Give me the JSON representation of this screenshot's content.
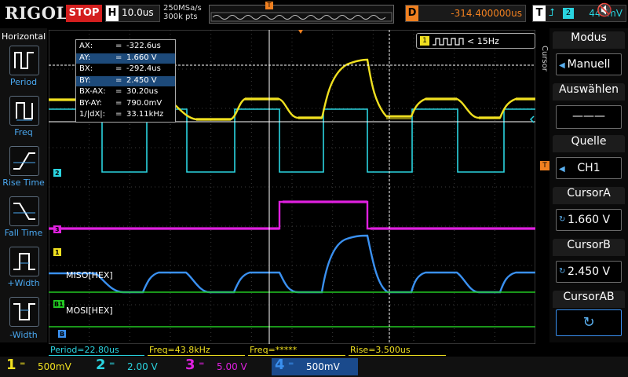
{
  "header": {
    "brand": "RIGOL",
    "run_state": "STOP",
    "timebase_label": "H",
    "timebase": "10.0us",
    "sample_rate": "250MSa/s",
    "memory_depth": "300k pts",
    "trigger_pos_marker": "T",
    "delay_label": "D",
    "delay": "-314.400000us",
    "trigger_label": "T",
    "trigger_edge_icon": "rising-edge-icon",
    "trigger_source": "2",
    "trigger_level": "440mV"
  },
  "left_panel": {
    "title": "Horizontal",
    "items": [
      {
        "label": "Period",
        "icon": "period-icon"
      },
      {
        "label": "Freq",
        "icon": "freq-icon"
      },
      {
        "label": "Rise Time",
        "icon": "rise-time-icon"
      },
      {
        "label": "Fall Time",
        "icon": "fall-time-icon"
      },
      {
        "label": "+Width",
        "icon": "positive-width-icon"
      },
      {
        "label": "-Width",
        "icon": "negative-width-icon"
      }
    ]
  },
  "cursor_readout": {
    "rows": [
      {
        "key": "AX:",
        "eq": "=",
        "value": "-322.6us",
        "selected": false
      },
      {
        "key": "AY:",
        "eq": "=",
        "value": "1.660 V",
        "selected": true
      },
      {
        "key": "BX:",
        "eq": "=",
        "value": "-292.4us",
        "selected": false
      },
      {
        "key": "BY:",
        "eq": "=",
        "value": "2.450 V",
        "selected": true
      },
      {
        "key": "BX-AX:",
        "eq": "=",
        "value": "30.20us",
        "selected": false
      },
      {
        "key": "BY-AY:",
        "eq": "=",
        "value": "790.0mV",
        "selected": false
      },
      {
        "key": "1/|dX|:",
        "eq": "=",
        "value": "33.11kHz",
        "selected": false
      }
    ]
  },
  "freq_counter": {
    "channel": "1",
    "text": "< 15Hz"
  },
  "waveform_labels": {
    "miso": "MISO[HEX]",
    "mosi": "MOSI[HEX]",
    "markers": [
      "2",
      "3",
      "1",
      "B1",
      "B"
    ]
  },
  "right_panel": {
    "side_title": "Cursor",
    "mode_label": "Modus",
    "mode_value": "Manuell",
    "select_label": "Auswählen",
    "select_value": "———",
    "source_label": "Quelle",
    "source_value": "CH1",
    "cursor_a_label": "CursorA",
    "cursor_a_value": "1.660 V",
    "cursor_b_label": "CursorB",
    "cursor_b_value": "2.450 V",
    "cursor_ab_label": "CursorAB",
    "cursor_ab_icon": "refresh-icon"
  },
  "measurements": [
    {
      "text": "Period=22.80us",
      "color": "#2ad4e0"
    },
    {
      "text": "Freq=43.8kHz",
      "color": "#f0e020"
    },
    {
      "text": "Freq=*****",
      "color": "#f0e020"
    },
    {
      "text": "Rise=3.500us",
      "color": "#f0e020"
    }
  ],
  "channels": [
    {
      "num": "1",
      "coupling": "DC",
      "scale": "500mV",
      "color": "#f0e020"
    },
    {
      "num": "2",
      "coupling": "DC",
      "scale": "2.00 V",
      "color": "#2ad4e0"
    },
    {
      "num": "3",
      "coupling": "DC",
      "scale": "5.00 V",
      "color": "#e020e0"
    },
    {
      "num": "4",
      "coupling": "DC",
      "scale": "500mV",
      "color": "#3a90f0"
    }
  ],
  "colors": {
    "ch1": "#f0e020",
    "ch2": "#2ad4e0",
    "ch3": "#e020e0",
    "ch4": "#3a90f0",
    "bus": "#22c822",
    "trigger": "#f08020",
    "stop": "#d41e1e"
  }
}
